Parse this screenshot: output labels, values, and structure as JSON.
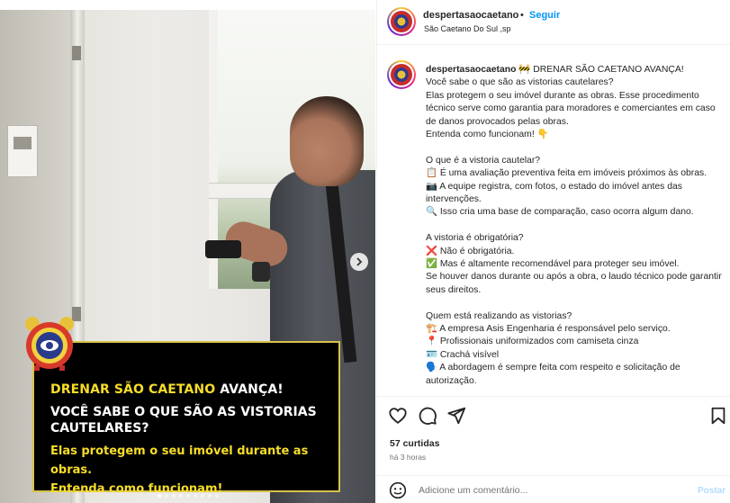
{
  "post": {
    "username": "despertasaocaetano",
    "follow_separator": "•",
    "follow_label": "Seguir",
    "location": "São Caetano Do Sul ,sp"
  },
  "media": {
    "overlay": {
      "title_yellow": "DRENAR SÃO CAETANO",
      "title_white": " AVANÇA!",
      "question": "VOCÊ SABE O QUE SÃO AS VISTORIAS CAUTELARES?",
      "line3": "Elas protegem o seu imóvel durante as obras.",
      "line4": "Entenda como funcionam!"
    },
    "next_icon": "chevron-right-icon",
    "slides_count": 9,
    "active_slide": 1
  },
  "caption": {
    "username": "despertasaocaetano",
    "lines": [
      " 🚧 DRENAR SÃO CAETANO AVANÇA!",
      "Você sabe o que são as vistorias cautelares?",
      "Elas protegem o seu imóvel durante as obras. Esse procedimento técnico serve como garantia para moradores e comerciantes em caso de danos provocados pelas obras.",
      "Entenda como funcionam! 👇",
      "",
      "O que é a vistoria cautelar?",
      "📋 É uma avaliação preventiva feita em imóveis próximos às obras.",
      "📷 A equipe registra, com fotos, o estado do imóvel antes das intervenções.",
      "🔍 Isso cria uma base de comparação, caso ocorra algum dano.",
      "",
      "A vistoria é obrigatória?",
      "❌ Não é obrigatória.",
      "✅ Mas é altamente recomendável para proteger seu imóvel.",
      "Se houver danos durante ou após a obra, o laudo técnico pode garantir seus direitos.",
      "",
      "Quem está realizando as vistorias?",
      "🏗️ A empresa Asis Engenharia é responsável pelo serviço.",
      "📍 Profissionais uniformizados com camiseta cinza",
      "🪪 Crachá visível",
      "🗣️ A abordagem é sempre feita com respeito e solicitação de autorização."
    ]
  },
  "actions": {
    "icons": [
      "heart-icon",
      "comment-icon",
      "share-icon",
      "bookmark-icon"
    ],
    "likes": "57 curtidas",
    "time": "há 3 horas"
  },
  "comment": {
    "placeholder": "Adicione um comentário...",
    "post_label": "Postar",
    "emoji_icon": "emoji-icon"
  },
  "colors": {
    "follow_blue": "#0095f6",
    "overlay_yellow": "#f7dd28",
    "post_disabled": "#b3dbff"
  }
}
